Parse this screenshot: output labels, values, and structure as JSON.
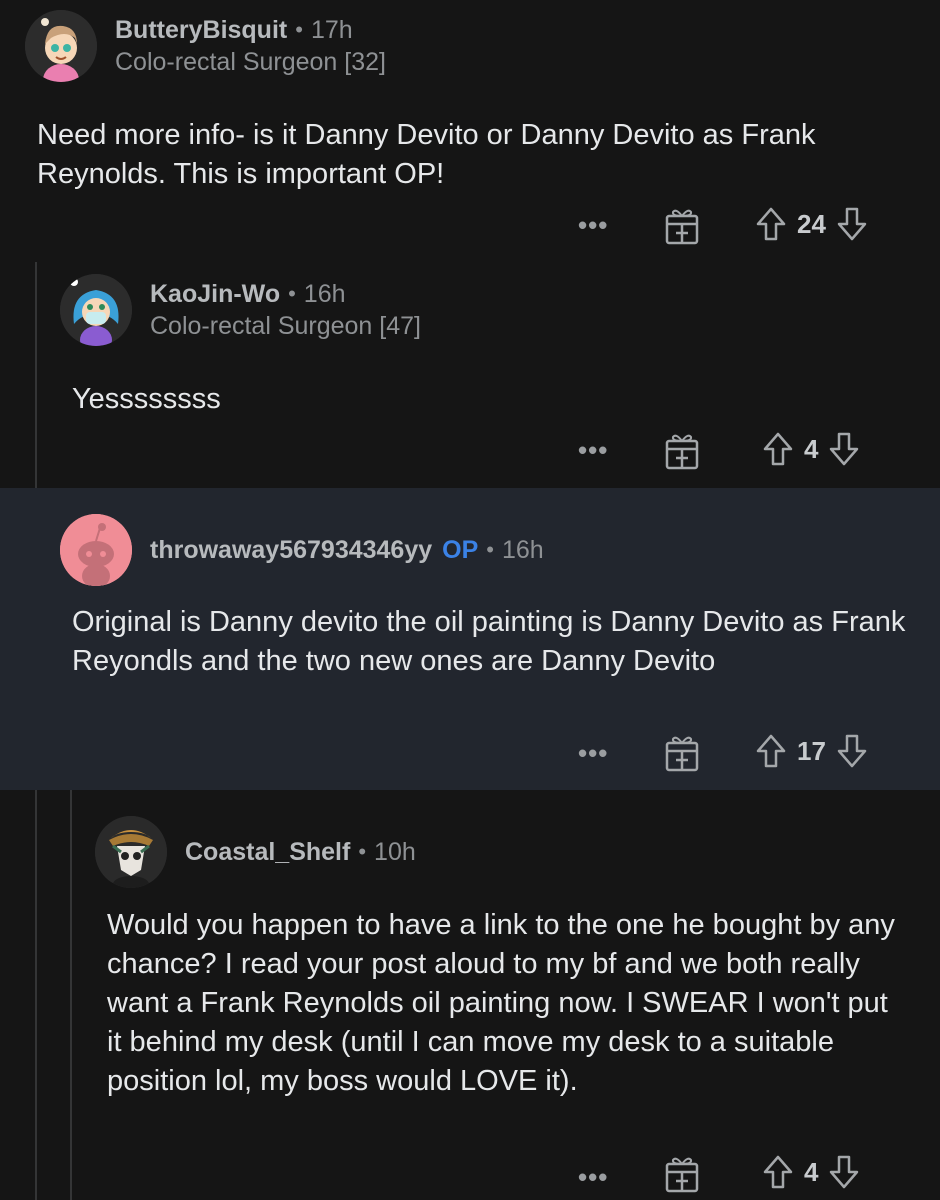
{
  "comments": [
    {
      "username": "ButteryBisquit",
      "time": "17h",
      "flair": "Colo-rectal Surgeon [32]",
      "body": "Need more info- is it Danny Devito or Danny Devito as Frank Reynolds.  This is important OP!",
      "votes": "24",
      "more": "•••"
    },
    {
      "username": "KaoJin-Wo",
      "time": "16h",
      "flair": "Colo-rectal Surgeon [47]",
      "body": "Yessssssss",
      "votes": "4",
      "more": "•••"
    },
    {
      "username": "throwaway567934346yy",
      "op_badge": "OP",
      "time": "16h",
      "body": "Original is Danny devito the oil painting is Danny Devito as Frank Reyondls and the two new ones are Danny Devito",
      "votes": "17",
      "more": "•••"
    },
    {
      "username": "Coastal_Shelf",
      "time": "10h",
      "body": "Would you happen to have a link to the one he bought by any chance? I read your post aloud to my bf and we both really want a Frank Reynolds oil painting now. I SWEAR I won't put it behind my desk (until I can move my desk to a suitable position lol, my boss would LOVE it).",
      "votes": "4",
      "more": "•••"
    }
  ],
  "separator": "•",
  "colors": {
    "background": "#151515",
    "highlight_background": "#22262e",
    "op_badge": "#3b82e6",
    "thread_line": "#343536"
  }
}
